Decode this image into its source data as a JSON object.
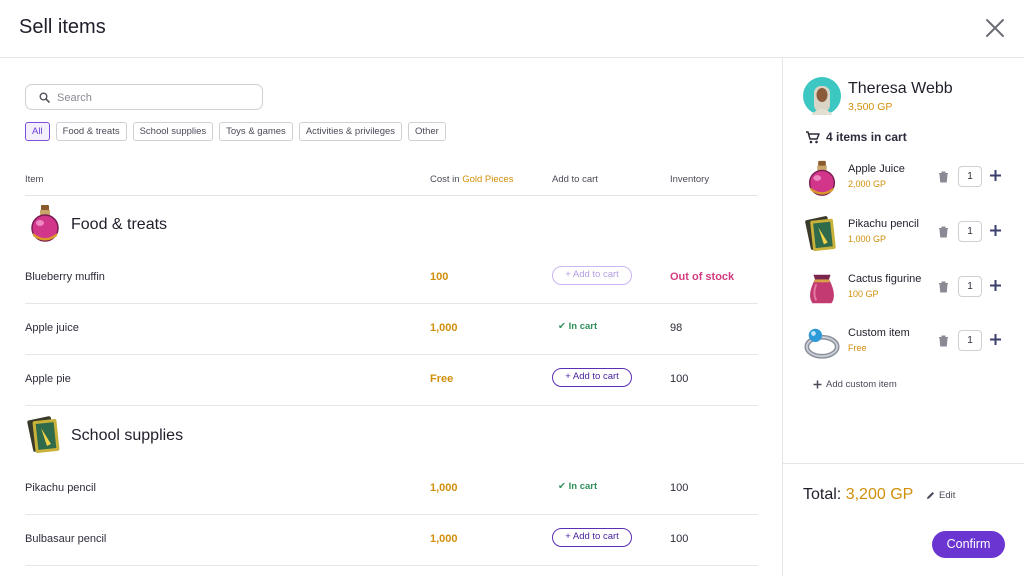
{
  "dialog": {
    "title": "Sell items",
    "close_icon": "close-icon"
  },
  "search": {
    "placeholder": "Search",
    "value": ""
  },
  "filters": [
    "All",
    "Food & treats",
    "School supplies",
    "Toys & games",
    "Activities & privileges",
    "Other"
  ],
  "active_filter": "All",
  "table": {
    "headers": {
      "item": "Item",
      "cost_prefix": "Cost in",
      "cost_highlight": "Gold Pieces",
      "add": "Add to cart",
      "inventory": "Inventory"
    },
    "groups": [
      {
        "name": "Food & treats",
        "icon": "potion-icon",
        "rows": [
          {
            "name": "Blueberry muffin",
            "cost": "100",
            "cart": "Add to cart",
            "cart_state": "disabled",
            "inventory": "Out of stock"
          },
          {
            "name": "Apple juice",
            "cost": "1,000",
            "cart": "In cart",
            "cart_state": "in-cart",
            "inventory": "98"
          },
          {
            "name": "Apple pie",
            "cost": "Free",
            "cart": "Add to cart",
            "cart_state": "available",
            "inventory": "100"
          }
        ]
      },
      {
        "name": "School supplies",
        "icon": "pencil-card-icon",
        "rows": [
          {
            "name": "Pikachu pencil",
            "cost": "1,000",
            "cart": "In cart",
            "cart_state": "in-cart",
            "inventory": "100"
          },
          {
            "name": "Bulbasaur pencil",
            "cost": "1,000",
            "cart": "Add to cart",
            "cart_state": "available",
            "inventory": "100"
          }
        ]
      }
    ]
  },
  "sidebar": {
    "user": {
      "name": "Theresa Webb",
      "gp": "3,500 GP"
    },
    "cart_count": "4 items in cart",
    "items": [
      {
        "name": "Apple Juice",
        "price": "2,000 GP",
        "qty": "1",
        "icon": "potion-icon"
      },
      {
        "name": "Pikachu pencil",
        "price": "1,000 GP",
        "qty": "1",
        "icon": "pencil-card-icon"
      },
      {
        "name": "Cactus figurine",
        "price": "100 GP",
        "qty": "1",
        "icon": "pouch-icon"
      },
      {
        "name": "Custom item",
        "price": "Free",
        "qty": "1",
        "icon": "ring-icon"
      }
    ],
    "add_custom": "Add custom item",
    "total_label": "Total:",
    "total_amount": "3,200 GP",
    "edit": "Edit",
    "confirm": "Confirm"
  },
  "colors": {
    "accent": "#6a35d1",
    "gold": "#d18f0b",
    "out_of_stock": "#d23c7f",
    "in_cart": "#2f8f5a"
  }
}
